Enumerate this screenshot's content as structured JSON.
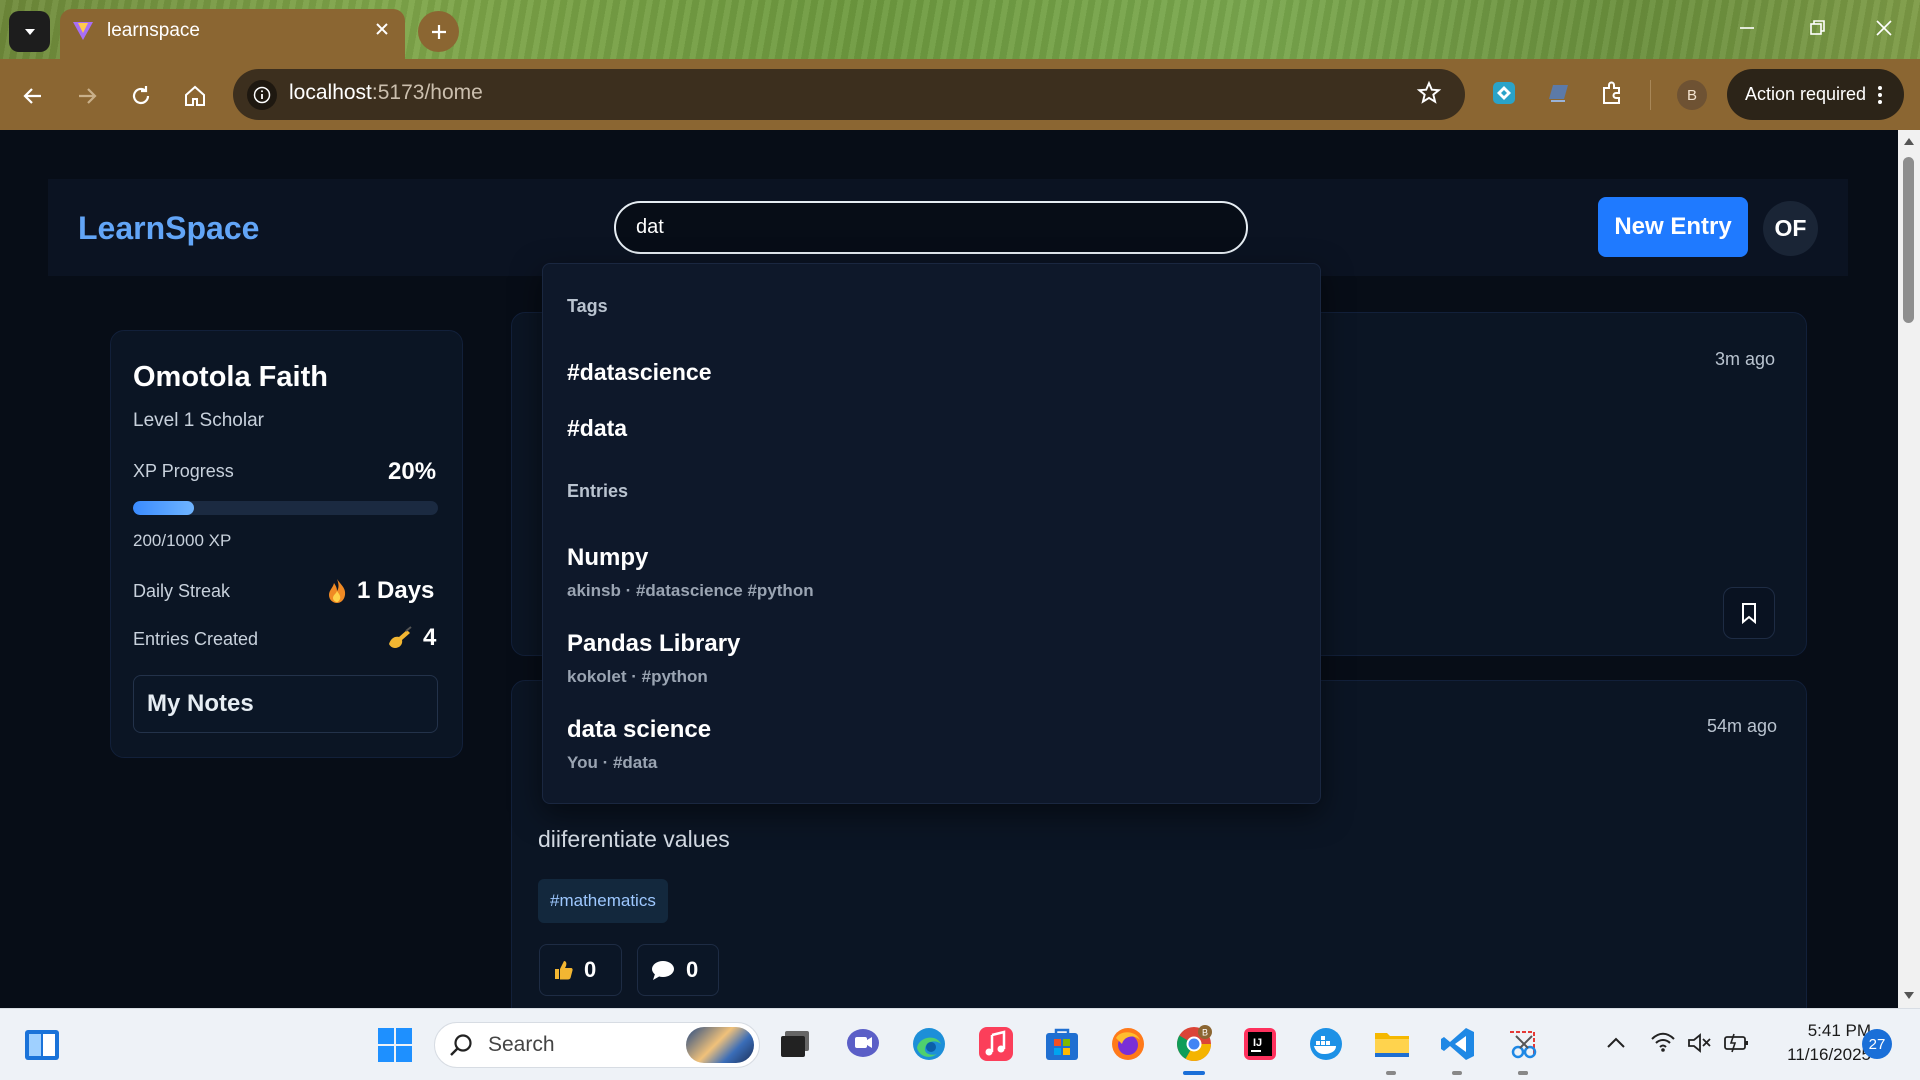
{
  "browser": {
    "tab_title": "learnspace",
    "url_host": "localhost",
    "url_path": ":5173/home",
    "profile_initial": "B",
    "action_required": "Action required"
  },
  "header": {
    "brand": "LearnSpace",
    "search_value": "dat",
    "new_entry": "New Entry",
    "avatar_initials": "OF"
  },
  "profile": {
    "name": "Omotola Faith",
    "level": "Level 1 Scholar",
    "xp_label": "XP Progress",
    "xp_percent": "20%",
    "xp_fraction": 0.2,
    "xp_text": "200/1000 XP",
    "streak_label": "Daily Streak",
    "streak_value": "1 Days",
    "entries_label": "Entries Created",
    "entries_value": "4",
    "my_notes": "My Notes"
  },
  "dropdown": {
    "tags_heading": "Tags",
    "tags": [
      "#datascience",
      "#data"
    ],
    "entries_heading": "Entries",
    "entries": [
      {
        "title": "Numpy",
        "meta": "akinsb · #datascience #python"
      },
      {
        "title": "Pandas Library",
        "meta": "kokolet · #python"
      },
      {
        "title": "data science",
        "meta": "You · #data"
      }
    ]
  },
  "feed": {
    "card1_time": "3m ago",
    "card2_time": "54m ago",
    "card2_body": "diiferentiate values",
    "card2_tag": "#mathematics",
    "likes": "0",
    "comments": "0"
  },
  "taskbar": {
    "search_placeholder": "Search",
    "time": "5:41 PM",
    "date": "11/16/2025",
    "notifications": "27"
  },
  "colors": {
    "accent": "#1f7aff",
    "brand": "#62a5f7",
    "page_bg": "#070d17",
    "chrome": "#8b6632"
  }
}
